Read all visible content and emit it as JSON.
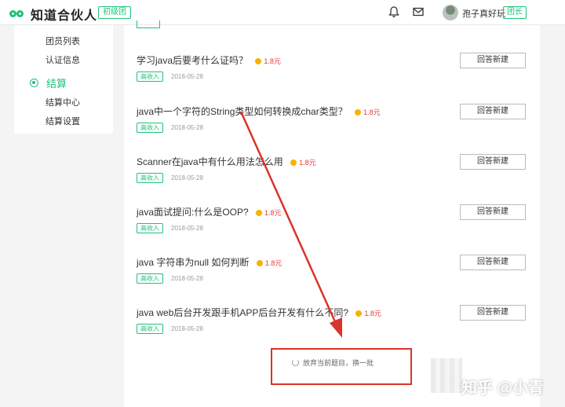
{
  "header": {
    "app_name": "知道合伙人",
    "level_badge": "初级团",
    "username": "孢子真好玩",
    "role_badge": "团长"
  },
  "sidebar": {
    "items": [
      {
        "label": "团员列表"
      },
      {
        "label": "认证信息"
      }
    ],
    "group": {
      "label": "结算"
    },
    "sub_items": [
      {
        "label": "结算中心"
      },
      {
        "label": "结算设置"
      }
    ]
  },
  "questions": [
    {
      "title": "学习java后要考什么证吗？",
      "reward": "1.8元",
      "tag": "高收入",
      "date": "2018-05-28",
      "button": "回答新建"
    },
    {
      "title": "java中一个字符的String类型如何转换成char类型？",
      "reward": "1.8元",
      "tag": "高收入",
      "date": "2018-05-28",
      "button": "回答新建"
    },
    {
      "title": "Scanner在java中有什么用法怎么用",
      "reward": "1.8元",
      "tag": "高收入",
      "date": "2018-05-28",
      "button": "回答新建"
    },
    {
      "title": "java面试提问:什么是OOP?",
      "reward": "1.8元",
      "tag": "高收入",
      "date": "2018-05-28",
      "button": "回答新建"
    },
    {
      "title": "java 字符串为null 如何判断",
      "reward": "1.8元",
      "tag": "高收入",
      "date": "2018-05-28",
      "button": "回答新建"
    },
    {
      "title": "java web后台开发跟手机APP后台开发有什么不同?",
      "reward": "1.8元",
      "tag": "高收入",
      "date": "2018-05-28",
      "button": "回答新建"
    }
  ],
  "refresh_label": "放弃当前题目，换一批",
  "watermark": "知乎 @小青",
  "colors": {
    "accent": "#1ec27a",
    "reward": "#e4393c",
    "annotation": "#d9342b",
    "coin": "#f5b400"
  }
}
